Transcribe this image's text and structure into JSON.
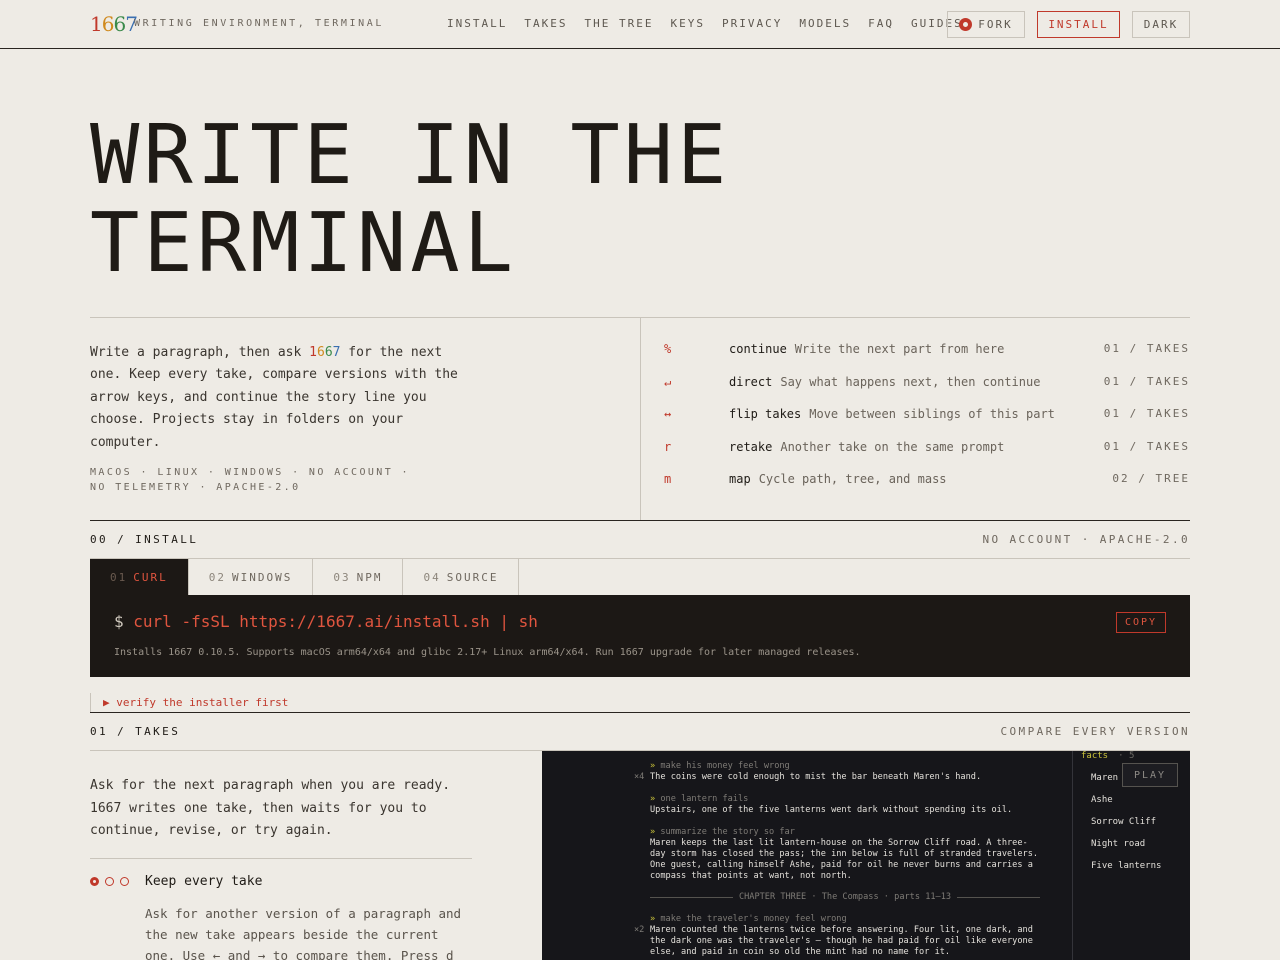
{
  "header": {
    "brand": [
      "1",
      "6",
      "6",
      "7"
    ],
    "tagline": "WRITING ENVIRONMENT, TERMINAL",
    "nav": [
      "INSTALL",
      "TAKES",
      "THE TREE",
      "KEYS",
      "PRIVACY",
      "MODELS",
      "FAQ",
      "GUIDES"
    ],
    "fork_label": "FORK",
    "install_label": "INSTALL",
    "theme_label": "DARK"
  },
  "hero": {
    "line1": "WRITE IN THE",
    "line2": "TERMINAL"
  },
  "intro": {
    "pre": "Write a paragraph, then ask ",
    "brand": [
      "1",
      "6",
      "6",
      "7"
    ],
    "post": " for the next one. Keep every take, compare versions with the arrow keys, and continue the story line you choose. Projects stay in folders on your computer.",
    "platforms": "MACOS · LINUX · WINDOWS · NO ACCOUNT · NO TELEMETRY · APACHE-2.0"
  },
  "keys": [
    {
      "symbol": "%",
      "command": "continue",
      "description": "Write the next part from here",
      "tag": "01 / TAKES"
    },
    {
      "symbol": "↵",
      "command": "direct",
      "description": "Say what happens next, then continue",
      "tag": "01 / TAKES"
    },
    {
      "symbol": "↔",
      "command": "flip takes",
      "description": "Move between siblings of this part",
      "tag": "01 / TAKES"
    },
    {
      "symbol": "r",
      "command": "retake",
      "description": "Another take on the same prompt",
      "tag": "01 / TAKES"
    },
    {
      "symbol": "m",
      "command": "map",
      "description": "Cycle path, tree, and mass",
      "tag": "02 / TREE"
    }
  ],
  "install": {
    "label": "00 / INSTALL",
    "right": "NO ACCOUNT · APACHE-2.0",
    "tabs": [
      {
        "num": "01",
        "label": "CURL"
      },
      {
        "num": "02",
        "label": "WINDOWS"
      },
      {
        "num": "03",
        "label": "NPM"
      },
      {
        "num": "04",
        "label": "SOURCE"
      }
    ],
    "prompt": "$",
    "command": "curl -fsSL https://1667.ai/install.sh | sh",
    "note": "Installs 1667 0.10.5. Supports macOS arm64/x64 and glibc 2.17+ Linux arm64/x64. Run 1667 upgrade for later managed releases.",
    "copy_label": "COPY",
    "verify": "▶ verify the installer first"
  },
  "takes": {
    "label": "01 / TAKES",
    "right": "COMPARE EVERY VERSION",
    "intro": "Ask for the next paragraph when you are ready. 1667 writes one take, then waits for you to continue, revise, or try again.",
    "feature_title": "Keep every take",
    "feature_body": "Ask for another version of a paragraph and the new take appears beside the current one. Use ← and → to compare them. Press d",
    "play_label": "PLAY",
    "facts_label": "facts",
    "facts_sep": "·",
    "facts_num": "5",
    "facts": [
      "Maren",
      "Ashe",
      "Sorrow Cliff",
      "Night road",
      "Five lanterns"
    ],
    "story": {
      "b1_mult": "×4",
      "b1_prompt": "make his money feel wrong",
      "b1_text": "The coins were cold enough to mist the bar beneath Maren's hand.",
      "b2_prompt": "one lantern fails",
      "b2_text": "Upstairs, one of the five lanterns went dark without spending its oil.",
      "b3_prompt": "summarize the story so far",
      "b3_text": "Maren keeps the last lit lantern-house on the Sorrow Cliff road. A three-day storm has closed the pass; the inn below is full of stranded travelers. One guest, calling himself Ashe, paid for oil he never burns and carries a compass that points at want, not north.",
      "chapter": "CHAPTER THREE · The Compass · parts 11–13",
      "b4_mult": "×2",
      "b4_prompt": "make the traveler's money feel wrong",
      "b4_text": "Maren counted the lanterns twice before answering. Four lit, one dark, and the dark one was the traveler's — though he had paid for oil like everyone else, and paid in coin so old the mint had no name for it."
    }
  }
}
